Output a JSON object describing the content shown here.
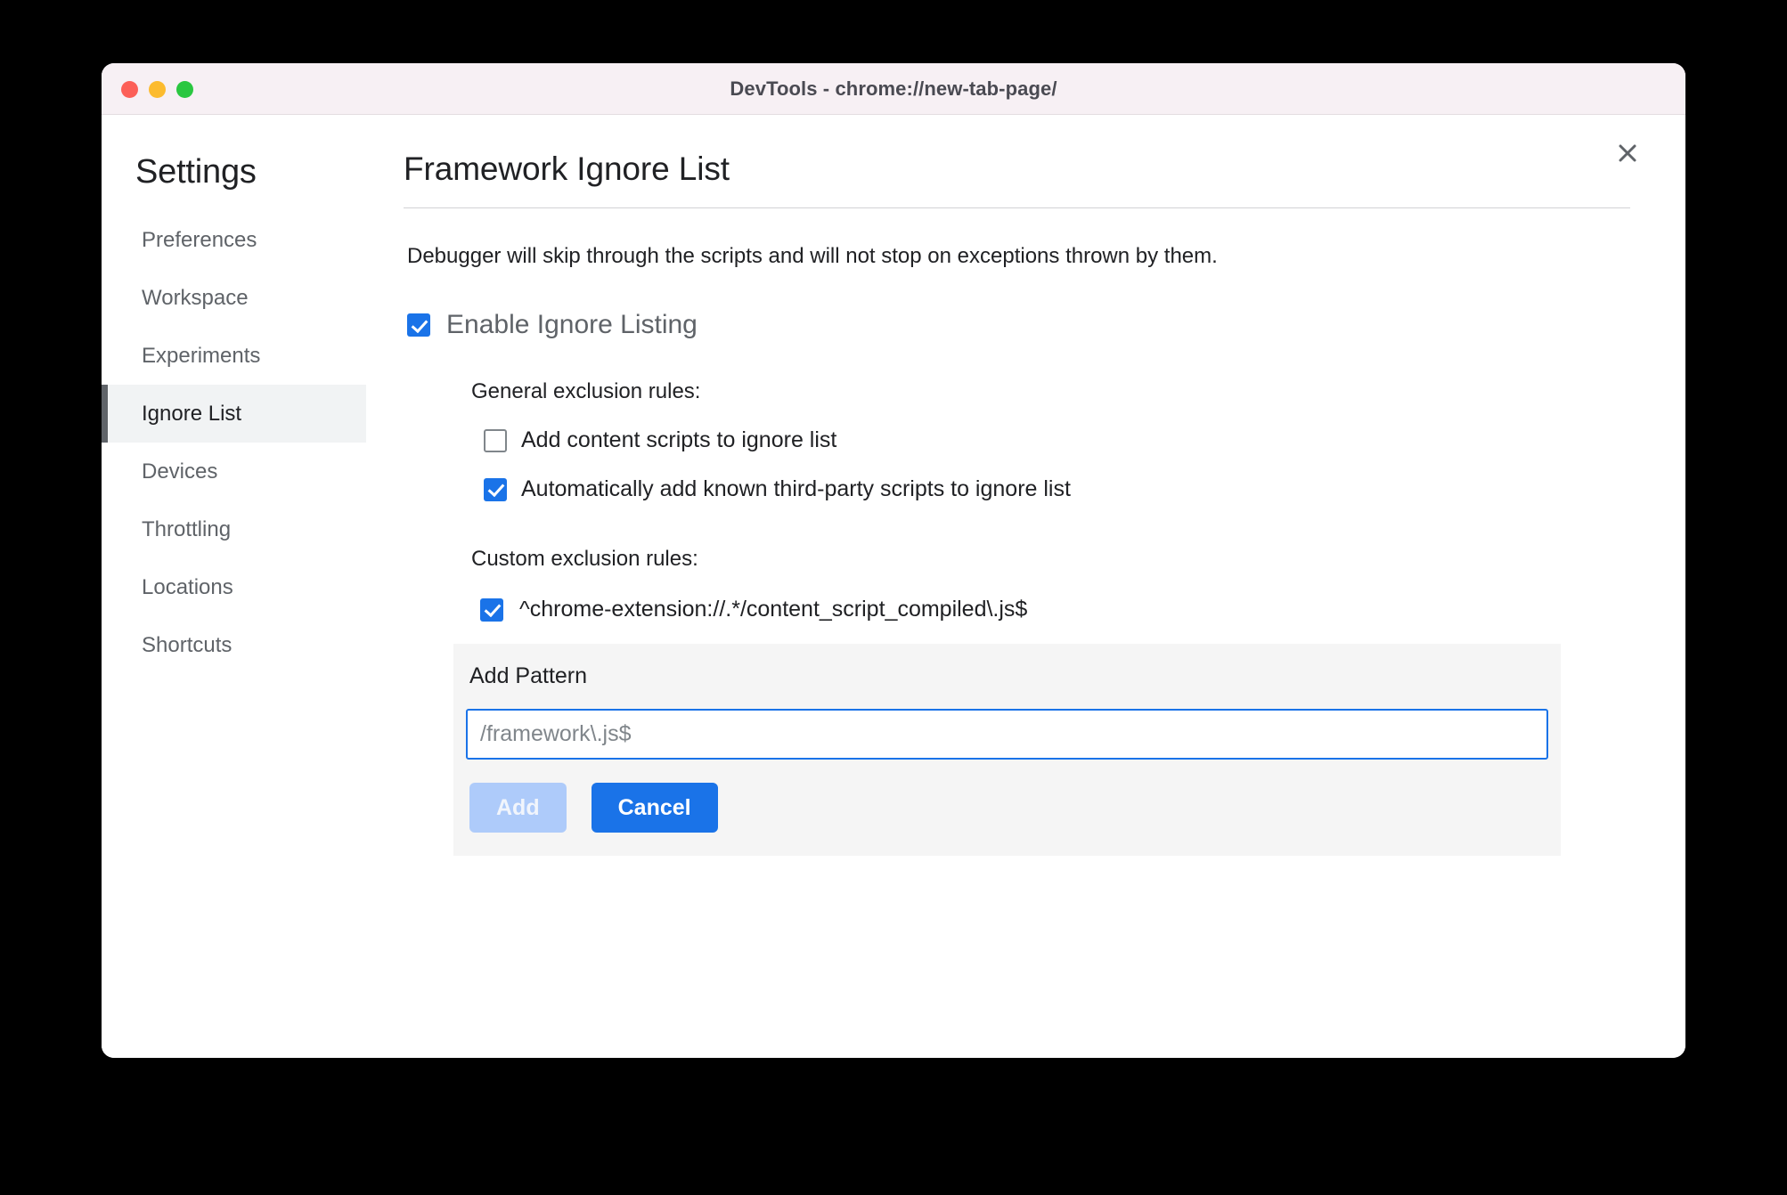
{
  "window": {
    "title": "DevTools - chrome://new-tab-page/",
    "traffic_lights": [
      "close",
      "minimize",
      "maximize"
    ],
    "close_icon": "close-icon"
  },
  "sidebar": {
    "heading": "Settings",
    "items": [
      {
        "label": "Preferences",
        "selected": false
      },
      {
        "label": "Workspace",
        "selected": false
      },
      {
        "label": "Experiments",
        "selected": false
      },
      {
        "label": "Ignore List",
        "selected": true
      },
      {
        "label": "Devices",
        "selected": false
      },
      {
        "label": "Throttling",
        "selected": false
      },
      {
        "label": "Locations",
        "selected": false
      },
      {
        "label": "Shortcuts",
        "selected": false
      }
    ]
  },
  "main": {
    "title": "Framework Ignore List",
    "description": "Debugger will skip through the scripts and will not stop on exceptions thrown by them.",
    "enable": {
      "label": "Enable Ignore Listing",
      "checked": true
    },
    "general_section": {
      "label": "General exclusion rules:",
      "options": [
        {
          "label": "Add content scripts to ignore list",
          "checked": false
        },
        {
          "label": "Automatically add known third-party scripts to ignore list",
          "checked": true
        }
      ]
    },
    "custom_section": {
      "label": "Custom exclusion rules:",
      "patterns": [
        {
          "label": "^chrome-extension://.*/content_script_compiled\\.js$",
          "checked": true
        }
      ]
    },
    "add_pattern": {
      "label": "Add Pattern",
      "input_value": "",
      "input_placeholder": "/framework\\.js$",
      "add_label": "Add",
      "cancel_label": "Cancel"
    }
  },
  "colors": {
    "accent": "#1a73e8",
    "accent_disabled": "#aecbfa",
    "selected_bg": "#f1f3f4",
    "titlebar_bg": "#f7f0f4",
    "panel_bg": "#f5f5f5"
  }
}
